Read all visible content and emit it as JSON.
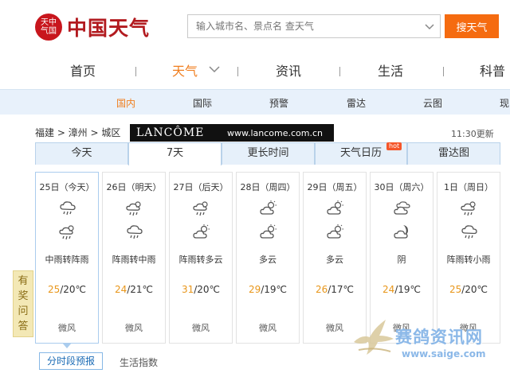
{
  "header": {
    "logo_seal": "天中气国",
    "logo_text": "中国天气",
    "search_placeholder": "输入城市名、景点名 查天气",
    "search_button": "搜天气"
  },
  "nav": [
    "首页",
    "天气",
    "资讯",
    "生活",
    "科普"
  ],
  "subnav": [
    "国内",
    "国际",
    "预警",
    "雷达",
    "云图",
    "现"
  ],
  "breadcrumb": "福建 > 漳州 > 城区",
  "ad": {
    "brand": "LANCÔME",
    "url": "www.lancome.com.cn"
  },
  "update_time": "11:30更新",
  "tabs": [
    "今天",
    "7天",
    "更长时间",
    "天气日历",
    "雷达图"
  ],
  "hot_badge": "hot",
  "days": [
    {
      "date": "25日（今天）",
      "icon1": "rain-cloud-icon",
      "icon2": "shower-icon",
      "desc": "中雨转阵雨",
      "high": "25",
      "low": "/20℃",
      "wind": "微风"
    },
    {
      "date": "26日（明天）",
      "icon1": "shower-icon",
      "icon2": "rain-cloud-icon",
      "desc": "阵雨转中雨",
      "high": "24",
      "low": "/21℃",
      "wind": "微风"
    },
    {
      "date": "27日（后天）",
      "icon1": "shower-icon",
      "icon2": "partly-cloudy-icon",
      "desc": "阵雨转多云",
      "high": "31",
      "low": "/20℃",
      "wind": "微风"
    },
    {
      "date": "28日（周四）",
      "icon1": "partly-cloudy-icon",
      "icon2": "partly-cloudy-icon",
      "desc": "多云",
      "high": "29",
      "low": "/19℃",
      "wind": "微风"
    },
    {
      "date": "29日（周五）",
      "icon1": "partly-cloudy-icon",
      "icon2": "partly-cloudy-icon",
      "desc": "多云",
      "high": "26",
      "low": "/17℃",
      "wind": "微风"
    },
    {
      "date": "30日（周六）",
      "icon1": "overcast-icon",
      "icon2": "cloudy-moon-icon",
      "desc": "阴",
      "high": "24",
      "low": "/19℃",
      "wind": "微风"
    },
    {
      "date": "1日（周日）",
      "icon1": "shower-icon",
      "icon2": "rain-cloud-icon",
      "desc": "阵雨转小雨",
      "high": "25",
      "low": "/20℃",
      "wind": "微风"
    }
  ],
  "feedback": [
    "有",
    "奖",
    "问",
    "答"
  ],
  "bottom": {
    "hourly_button": "分时段预报",
    "life_link": "生活指数"
  },
  "watermark": {
    "name": "赛鸽资讯网",
    "url": "www.saige.com"
  },
  "colors": {
    "accent": "#f07e1e",
    "search_button": "#f56b10",
    "brand_red": "#b21a1f",
    "tab_bg": "#e6f0fa",
    "temp_high": "#e8961a"
  }
}
